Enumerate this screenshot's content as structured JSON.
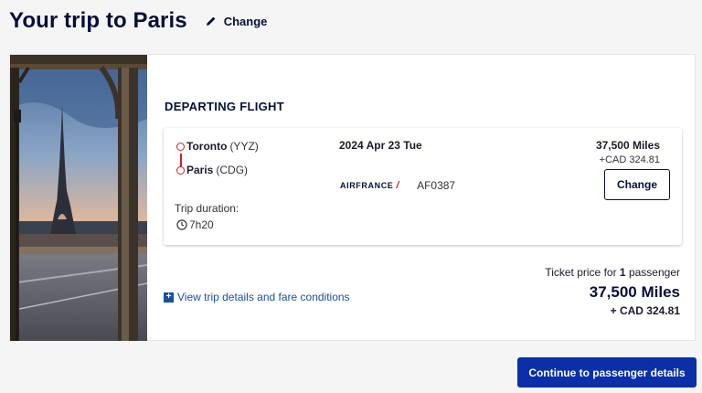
{
  "header": {
    "title": "Your trip to Paris",
    "change_label": "Change"
  },
  "section": {
    "title": "DEPARTING FLIGHT"
  },
  "flight": {
    "origin_city": "Toronto",
    "origin_code": "(YYZ)",
    "destination_city": "Paris",
    "destination_code": "(CDG)",
    "duration_label": "Trip duration:",
    "duration": "7h20",
    "date": "2024 Apr 23 Tue",
    "airline_logo_text": "AIRFRANCE",
    "flight_number": "AF0387",
    "miles": "37,500 Miles",
    "cad": "+CAD 324.81",
    "change_label": "Change"
  },
  "summary": {
    "details_link": "View trip details and fare conditions",
    "price_label_prefix": "Ticket price for",
    "passenger_count": "1",
    "price_label_suffix": "passenger",
    "total_miles": "37,500 Miles",
    "total_cad": "+ CAD 324.81"
  },
  "footer": {
    "continue_label": "Continue to passenger details"
  },
  "colors": {
    "brand_navy": "#051039",
    "primary_button": "#0a2fa8",
    "route_red": "#d0202a",
    "link_blue": "#1a4fa0"
  }
}
